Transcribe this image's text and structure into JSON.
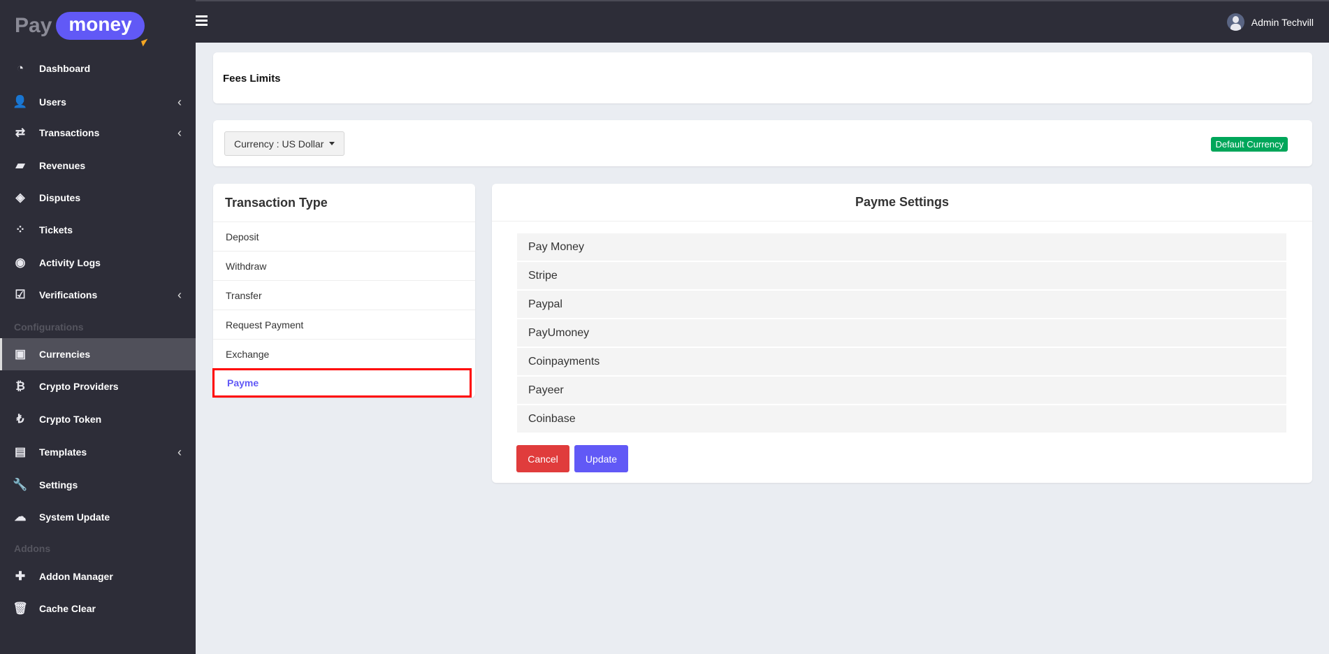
{
  "brand": {
    "pay": "Pay",
    "money": "money"
  },
  "header": {
    "user_name": "Admin Techvill"
  },
  "sidebar": {
    "items": [
      {
        "label": "Dashboard",
        "icon": "dashboard-icon",
        "glyph": "◔"
      },
      {
        "label": "Users",
        "icon": "user-icon",
        "glyph": "👤",
        "chevron": true
      },
      {
        "label": "Transactions",
        "icon": "transactions-icon",
        "glyph": "⇄",
        "chevron": true
      },
      {
        "label": "Revenues",
        "icon": "book-icon",
        "glyph": "▰"
      },
      {
        "label": "Disputes",
        "icon": "ticket-icon",
        "glyph": "◈"
      },
      {
        "label": "Tickets",
        "icon": "spinner-icon",
        "glyph": "⁘"
      },
      {
        "label": "Activity Logs",
        "icon": "eye-icon",
        "glyph": "◉"
      },
      {
        "label": "Verifications",
        "icon": "check-square-icon",
        "glyph": "☑",
        "chevron": true
      }
    ],
    "section_config": "Configurations",
    "config_items": [
      {
        "label": "Currencies",
        "icon": "money-bill-icon",
        "glyph": "▣",
        "active": true
      },
      {
        "label": "Crypto Providers",
        "icon": "bitcoin-icon",
        "glyph": "₿"
      },
      {
        "label": "Crypto Token",
        "icon": "lira-icon",
        "glyph": "₺"
      },
      {
        "label": "Templates",
        "icon": "newspaper-icon",
        "glyph": "▤",
        "chevron": true
      },
      {
        "label": "Settings",
        "icon": "wrench-icon",
        "glyph": "🔧"
      },
      {
        "label": "System Update",
        "icon": "cloud-upload-icon",
        "glyph": "☁"
      }
    ],
    "section_addons": "Addons",
    "addon_items": [
      {
        "label": "Addon Manager",
        "icon": "puzzle-icon",
        "glyph": "✚"
      },
      {
        "label": "Cache Clear",
        "icon": "trash-icon",
        "glyph": "🗑"
      }
    ]
  },
  "page": {
    "title": "Fees Limits"
  },
  "currency": {
    "label": "Currency : US Dollar",
    "badge": "Default Currency"
  },
  "transaction_type": {
    "title": "Transaction Type",
    "items": [
      "Deposit",
      "Withdraw",
      "Transfer",
      "Request Payment",
      "Exchange",
      "Payme"
    ],
    "selected": "Payme"
  },
  "settings": {
    "title": "Payme Settings",
    "items": [
      "Pay Money",
      "Stripe",
      "Paypal",
      "PayUmoney",
      "Coinpayments",
      "Payeer",
      "Coinbase"
    ],
    "cancel": "Cancel",
    "update": "Update"
  },
  "colors": {
    "accent": "#6159f6",
    "danger": "#e03c3c",
    "success": "#00a65a",
    "sidebar": "#2d2d38"
  }
}
